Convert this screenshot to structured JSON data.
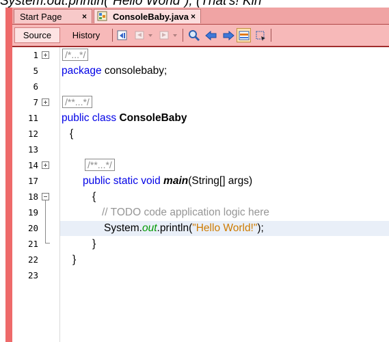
{
  "top_text": "System.out.println(\"Hello World\"); (That's! Kin",
  "tabs": [
    {
      "label": "Start Page",
      "close": "×"
    },
    {
      "label": "ConsoleBaby.java",
      "close": "×"
    }
  ],
  "toolbar": {
    "source_label": "Source",
    "history_label": "History"
  },
  "colors": {
    "keyword": "#0000e6",
    "string": "#ce7b00",
    "field": "#009900",
    "comment": "#969696",
    "highlight": "#e9eff8",
    "chrome": "#f7b9b9"
  },
  "editor": {
    "line_numbers": [
      "1",
      "5",
      "6",
      "7",
      "11",
      "12",
      "13",
      "14",
      "17",
      "18",
      "19",
      "20",
      "21",
      "22",
      "23"
    ],
    "collapsed_header": "/*...*/",
    "package_kw": "package",
    "package_name": " consolebaby;",
    "collapsed_javadoc_class": "/**...*/",
    "class_kw": "public class",
    "class_name": "ConsoleBaby",
    "open_brace": "{",
    "collapsed_javadoc_method": "/**...*/",
    "method_kw": "public static void",
    "method_name": "main",
    "method_params": "(String[] args)",
    "method_open": "{",
    "todo_comment": "// TODO code application logic here",
    "print_system": "System.",
    "print_out": "out",
    "print_call": ".println(",
    "print_string": "\"Hello World!\"",
    "print_end": ");",
    "method_close": "}",
    "class_close": "}"
  }
}
